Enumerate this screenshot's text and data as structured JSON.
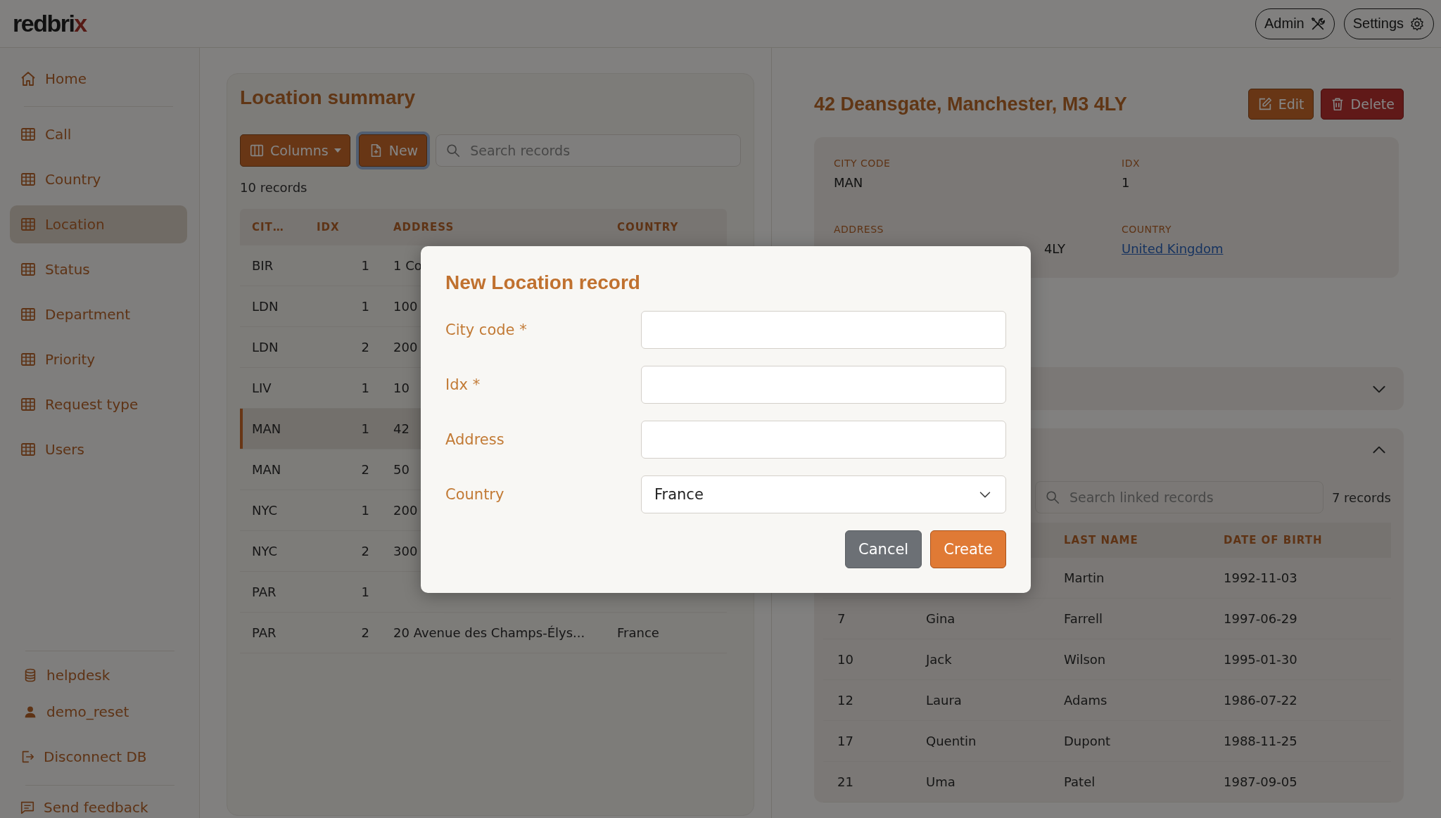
{
  "header": {
    "logo": "redbrix",
    "buttons": [
      {
        "label": "Admin"
      },
      {
        "label": "Settings"
      }
    ]
  },
  "sidebar": {
    "home": {
      "label": "Home",
      "selected": false
    },
    "tables": [
      {
        "label": "Call",
        "selected": false
      },
      {
        "label": "Country",
        "selected": false
      },
      {
        "label": "Location",
        "selected": true
      },
      {
        "label": "Status",
        "selected": false
      },
      {
        "label": "Department",
        "selected": false
      },
      {
        "label": "Priority",
        "selected": false
      },
      {
        "label": "Request type",
        "selected": false
      },
      {
        "label": "Users",
        "selected": false
      }
    ],
    "footer": [
      {
        "label": "helpdesk"
      },
      {
        "label": "demo_reset"
      },
      {
        "label": "Disconnect DB"
      },
      {
        "label": "Send feedback"
      }
    ]
  },
  "summary": {
    "title": "Location summary",
    "columns_button": "Columns",
    "new_button": "New",
    "search": {
      "placeholder": "Search records"
    },
    "count": "10 records",
    "table": {
      "columns": [
        "CIT…",
        "IDX",
        "ADDRESS",
        "COUNTRY"
      ],
      "rows": [
        {
          "cells": [
            "BIR",
            "1",
            "1 Co",
            null
          ],
          "selected": false
        },
        {
          "cells": [
            "LDN",
            "1",
            "100",
            null
          ],
          "selected": false
        },
        {
          "cells": [
            "LDN",
            "2",
            "200",
            null
          ],
          "selected": false
        },
        {
          "cells": [
            "LIV",
            "1",
            "10",
            null
          ],
          "selected": false
        },
        {
          "cells": [
            "MAN",
            "1",
            "42",
            null
          ],
          "selected": true
        },
        {
          "cells": [
            "MAN",
            "2",
            "50",
            null
          ],
          "selected": false
        },
        {
          "cells": [
            "NYC",
            "1",
            "200",
            null
          ],
          "selected": false
        },
        {
          "cells": [
            "NYC",
            "2",
            "300",
            null
          ],
          "selected": false
        },
        {
          "cells": [
            "PAR",
            "1",
            null,
            null
          ],
          "selected": false
        },
        {
          "cells": [
            "PAR",
            "2",
            "20 Avenue des Champs-Élys...",
            "France"
          ],
          "selected": false
        }
      ]
    }
  },
  "detail": {
    "title": "42 Deansgate, Manchester, M3 4LY",
    "edit_button": "Edit",
    "delete_button": "Delete",
    "fields": [
      {
        "label": "CITY CODE",
        "value": "MAN",
        "kind": "text"
      },
      {
        "label": "IDX",
        "value": "1",
        "kind": "text"
      },
      {
        "label": "ADDRESS",
        "value": "4LY",
        "kind": "tail"
      },
      {
        "label": "COUNTRY",
        "value": "United Kingdom",
        "kind": "link"
      }
    ],
    "sections": [
      {
        "expanded": false
      },
      {
        "expanded": true,
        "search": {
          "placeholder": "Search linked records"
        },
        "count": "7 records",
        "table": {
          "columns": [
            null,
            null,
            "LAST NAME",
            "DATE OF BIRTH"
          ],
          "rows": [
            [
              null,
              null,
              "Martin",
              "1992-11-03"
            ],
            [
              "7",
              "Gina",
              "Farrell",
              "1997-06-29"
            ],
            [
              "10",
              "Jack",
              "Wilson",
              "1995-01-30"
            ],
            [
              "12",
              "Laura",
              "Adams",
              "1986-07-22"
            ],
            [
              "17",
              "Quentin",
              "Dupont",
              "1988-11-25"
            ],
            [
              "21",
              "Uma",
              "Patel",
              "1987-09-05"
            ]
          ]
        }
      }
    ]
  },
  "modal": {
    "title": "New Location record",
    "fields": [
      {
        "label": "City code *",
        "kind": "input"
      },
      {
        "label": "Idx *",
        "kind": "input"
      },
      {
        "label": "Address",
        "kind": "input"
      },
      {
        "label": "Country",
        "kind": "select",
        "value": "France"
      }
    ],
    "buttons": [
      {
        "label": "Cancel",
        "kind": "secondary"
      },
      {
        "label": "Create",
        "kind": "primary"
      }
    ]
  }
}
